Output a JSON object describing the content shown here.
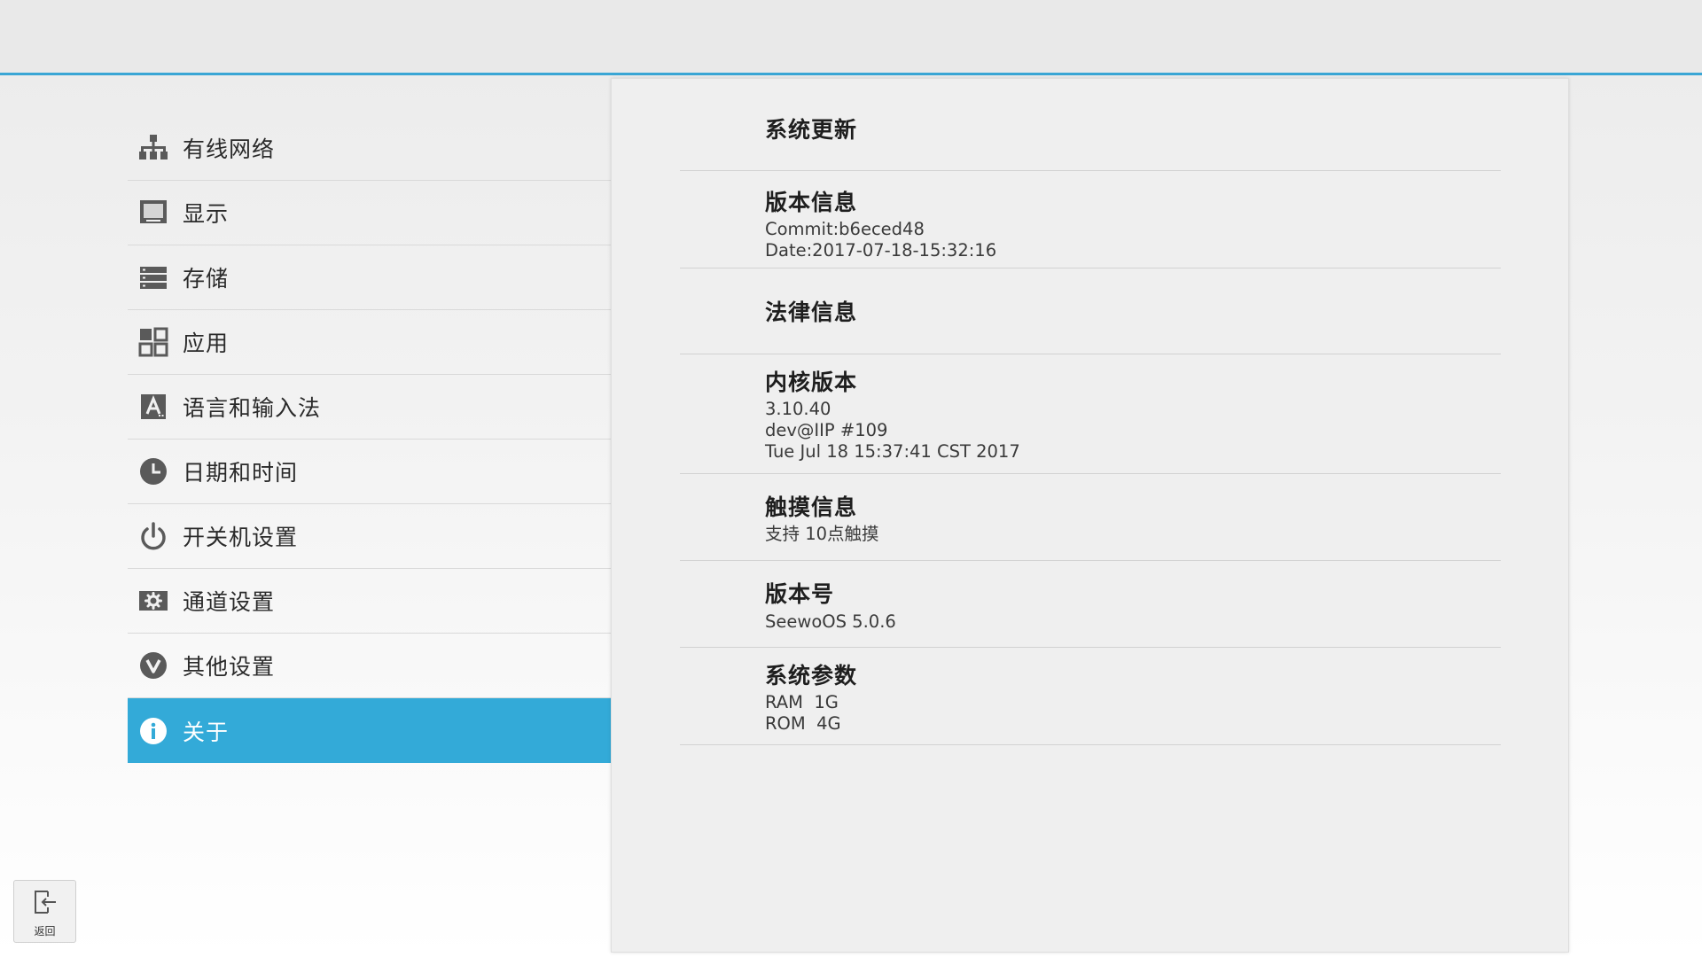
{
  "nav": {
    "items": [
      {
        "label": "有线网络",
        "icon": "wired-network-icon"
      },
      {
        "label": "显示",
        "icon": "display-icon"
      },
      {
        "label": "存储",
        "icon": "storage-icon"
      },
      {
        "label": "应用",
        "icon": "apps-icon"
      },
      {
        "label": "语言和输入法",
        "icon": "language-input-icon"
      },
      {
        "label": "日期和时间",
        "icon": "clock-icon"
      },
      {
        "label": "开关机设置",
        "icon": "power-icon"
      },
      {
        "label": "通道设置",
        "icon": "channel-settings-icon"
      },
      {
        "label": "其他设置",
        "icon": "other-settings-icon"
      },
      {
        "label": "关于",
        "icon": "info-icon",
        "active": true
      }
    ]
  },
  "about": {
    "system_update": {
      "title": "系统更新"
    },
    "version_info": {
      "title": "版本信息",
      "line1": "Commit:b6eced48",
      "line2": "Date:2017-07-18-15:32:16"
    },
    "legal_info": {
      "title": "法律信息"
    },
    "kernel_version": {
      "title": "内核版本",
      "line1": "3.10.40",
      "line2": "dev@IIP #109",
      "line3": "Tue Jul 18 15:37:41 CST 2017"
    },
    "touch_info": {
      "title": "触摸信息",
      "line1": "支持 10点触摸"
    },
    "version_number": {
      "title": "版本号",
      "line1": "SeewoOS 5.0.6"
    },
    "system_params": {
      "title": "系统参数",
      "line1": "RAM  1G",
      "line2": "ROM  4G"
    }
  },
  "back_button": {
    "label": "返回",
    "icon": "exit-icon"
  },
  "colors": {
    "accent": "#33aad8",
    "topbar_line": "#3aa6d5",
    "icon_gray": "#5a5a5a"
  }
}
